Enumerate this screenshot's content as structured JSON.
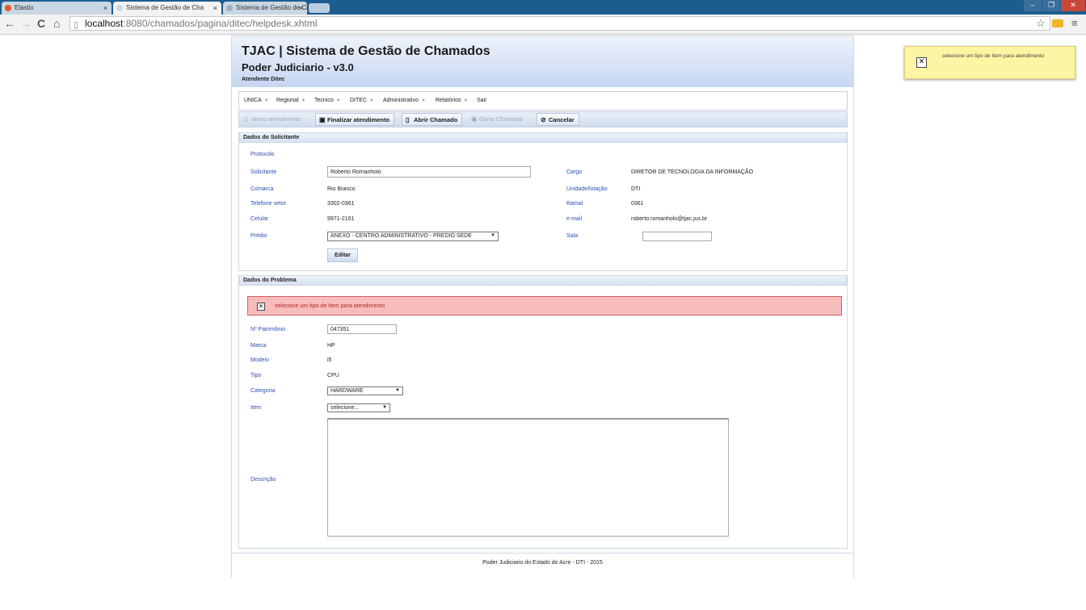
{
  "browser": {
    "tabs": [
      {
        "label": "Elastix"
      },
      {
        "label": "Sistema de Gestão de Cha"
      },
      {
        "label": "Sistema de Gestão de Cha"
      }
    ],
    "url_host": "localhost",
    "url_path": ":8080/chamados/pagina/ditec/helpdesk.xhtml"
  },
  "header": {
    "title": "TJAC | Sistema de Gestão de Chamados",
    "subtitle": "Poder Judiciario - v3.0",
    "user": "Atendente Ditec"
  },
  "menu": {
    "items": [
      {
        "label": "UNICA"
      },
      {
        "label": "Regional"
      },
      {
        "label": "Tecnico"
      },
      {
        "label": "DITEC"
      },
      {
        "label": "Administrativo"
      },
      {
        "label": "Relatórios"
      },
      {
        "label": "Sair"
      }
    ]
  },
  "toolbar": {
    "novo": "Novo atendimento",
    "finalizar": "Finalizar atendimento",
    "abrir": "Abrir Chamado",
    "gerar": "Gerar Chamado",
    "cancelar": "Cancelar"
  },
  "solicitante": {
    "heading": "Dados do Solicitante",
    "protocolo_label": "Protocolo",
    "solicitante_label": "Solicitante",
    "solicitante_value": "Roberto Romanholo",
    "cargo_label": "Cargo",
    "cargo_value": "DIRETOR DE TECNOLOGIA DA INFORMAÇÃO",
    "comarca_label": "Comarca",
    "comarca_value": "Rio Branco",
    "unidade_label": "Unidade/lotação",
    "unidade_value": "DTI",
    "telefone_label": "Telefone setor",
    "telefone_value": "3302-0361",
    "ramal_label": "Ramal",
    "ramal_value": "0361",
    "celular_label": "Celular",
    "celular_value": "9971-2161",
    "email_label": "e-mail",
    "email_value": "roberto.romanholo@tjac.jus.br",
    "predio_label": "Prédio",
    "predio_value": "ANEXO - CENTRO ADMINISTRATIVO - PREDIO SEDE",
    "sala_label": "Sala",
    "sala_value": "",
    "editar": "Editar"
  },
  "problema": {
    "heading": "Dados do Problema",
    "error": "selecione um tipo de Item para atendimento",
    "patrimonio_label": "Nº Patrimônio",
    "patrimonio_value": "047351",
    "marca_label": "Marca",
    "marca_value": "HP",
    "modelo_label": "Modelo",
    "modelo_value": "i5",
    "tipo_label": "Tipo",
    "tipo_value": "CPU",
    "categoria_label": "Categoria",
    "categoria_value": "HARDWARE",
    "item_label": "Item",
    "item_value": "selecione...",
    "descricao_label": "Descrição",
    "descricao_value": ""
  },
  "footer": "Poder Judiciario do Estado do Acre - DTI - 2015",
  "growl": {
    "message": "selecione um tipo de Item para atendimento"
  },
  "colors": {
    "header_gradient_bottom": "#c6d6f1",
    "label_blue": "#2b4fb0",
    "error_bg": "#f7bcbc",
    "error_text": "#b8282e",
    "growl_bg": "#fdf4a4"
  }
}
